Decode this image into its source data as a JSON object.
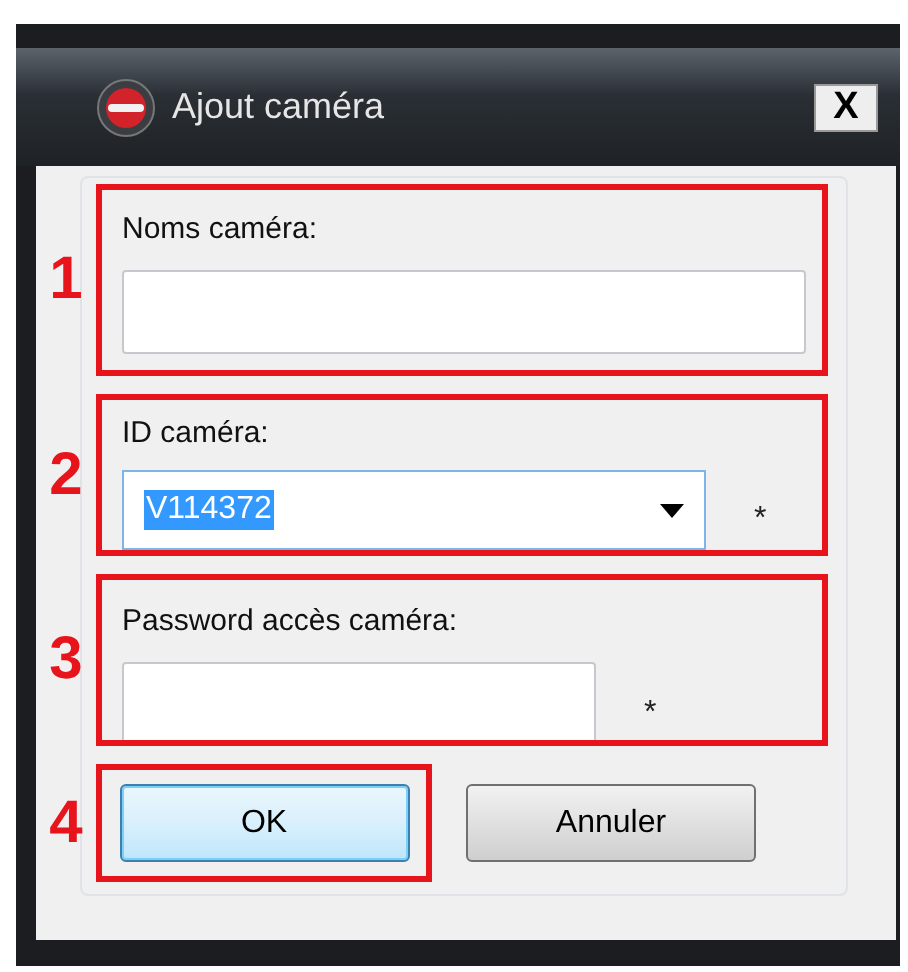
{
  "window": {
    "title": "Ajout caméra",
    "close_label": "X"
  },
  "sections": [
    {
      "marker": "1",
      "kind": "text",
      "label": "Noms caméra:"
    },
    {
      "marker": "2",
      "kind": "combo",
      "label": "ID caméra:",
      "value": "V114372",
      "value_highlighted": true,
      "required_mark": "*"
    },
    {
      "marker": "3",
      "kind": "password",
      "label": "Password accès caméra:",
      "required_mark": "*"
    }
  ],
  "buttons": [
    {
      "label": "OK",
      "marker": "4",
      "default": true
    },
    {
      "label": "Annuler",
      "default": false
    }
  ]
}
